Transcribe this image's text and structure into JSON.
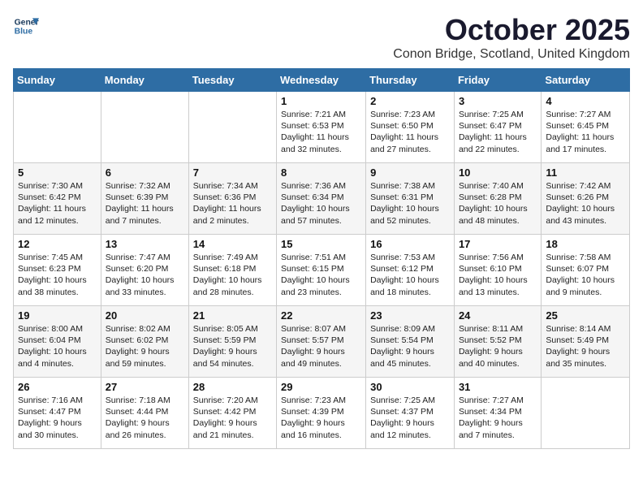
{
  "logo": {
    "line1": "General",
    "line2": "Blue"
  },
  "title": "October 2025",
  "location": "Conon Bridge, Scotland, United Kingdom",
  "weekdays": [
    "Sunday",
    "Monday",
    "Tuesday",
    "Wednesday",
    "Thursday",
    "Friday",
    "Saturday"
  ],
  "weeks": [
    [
      {
        "day": "",
        "info": ""
      },
      {
        "day": "",
        "info": ""
      },
      {
        "day": "",
        "info": ""
      },
      {
        "day": "1",
        "info": "Sunrise: 7:21 AM\nSunset: 6:53 PM\nDaylight: 11 hours\nand 32 minutes."
      },
      {
        "day": "2",
        "info": "Sunrise: 7:23 AM\nSunset: 6:50 PM\nDaylight: 11 hours\nand 27 minutes."
      },
      {
        "day": "3",
        "info": "Sunrise: 7:25 AM\nSunset: 6:47 PM\nDaylight: 11 hours\nand 22 minutes."
      },
      {
        "day": "4",
        "info": "Sunrise: 7:27 AM\nSunset: 6:45 PM\nDaylight: 11 hours\nand 17 minutes."
      }
    ],
    [
      {
        "day": "5",
        "info": "Sunrise: 7:30 AM\nSunset: 6:42 PM\nDaylight: 11 hours\nand 12 minutes."
      },
      {
        "day": "6",
        "info": "Sunrise: 7:32 AM\nSunset: 6:39 PM\nDaylight: 11 hours\nand 7 minutes."
      },
      {
        "day": "7",
        "info": "Sunrise: 7:34 AM\nSunset: 6:36 PM\nDaylight: 11 hours\nand 2 minutes."
      },
      {
        "day": "8",
        "info": "Sunrise: 7:36 AM\nSunset: 6:34 PM\nDaylight: 10 hours\nand 57 minutes."
      },
      {
        "day": "9",
        "info": "Sunrise: 7:38 AM\nSunset: 6:31 PM\nDaylight: 10 hours\nand 52 minutes."
      },
      {
        "day": "10",
        "info": "Sunrise: 7:40 AM\nSunset: 6:28 PM\nDaylight: 10 hours\nand 48 minutes."
      },
      {
        "day": "11",
        "info": "Sunrise: 7:42 AM\nSunset: 6:26 PM\nDaylight: 10 hours\nand 43 minutes."
      }
    ],
    [
      {
        "day": "12",
        "info": "Sunrise: 7:45 AM\nSunset: 6:23 PM\nDaylight: 10 hours\nand 38 minutes."
      },
      {
        "day": "13",
        "info": "Sunrise: 7:47 AM\nSunset: 6:20 PM\nDaylight: 10 hours\nand 33 minutes."
      },
      {
        "day": "14",
        "info": "Sunrise: 7:49 AM\nSunset: 6:18 PM\nDaylight: 10 hours\nand 28 minutes."
      },
      {
        "day": "15",
        "info": "Sunrise: 7:51 AM\nSunset: 6:15 PM\nDaylight: 10 hours\nand 23 minutes."
      },
      {
        "day": "16",
        "info": "Sunrise: 7:53 AM\nSunset: 6:12 PM\nDaylight: 10 hours\nand 18 minutes."
      },
      {
        "day": "17",
        "info": "Sunrise: 7:56 AM\nSunset: 6:10 PM\nDaylight: 10 hours\nand 13 minutes."
      },
      {
        "day": "18",
        "info": "Sunrise: 7:58 AM\nSunset: 6:07 PM\nDaylight: 10 hours\nand 9 minutes."
      }
    ],
    [
      {
        "day": "19",
        "info": "Sunrise: 8:00 AM\nSunset: 6:04 PM\nDaylight: 10 hours\nand 4 minutes."
      },
      {
        "day": "20",
        "info": "Sunrise: 8:02 AM\nSunset: 6:02 PM\nDaylight: 9 hours\nand 59 minutes."
      },
      {
        "day": "21",
        "info": "Sunrise: 8:05 AM\nSunset: 5:59 PM\nDaylight: 9 hours\nand 54 minutes."
      },
      {
        "day": "22",
        "info": "Sunrise: 8:07 AM\nSunset: 5:57 PM\nDaylight: 9 hours\nand 49 minutes."
      },
      {
        "day": "23",
        "info": "Sunrise: 8:09 AM\nSunset: 5:54 PM\nDaylight: 9 hours\nand 45 minutes."
      },
      {
        "day": "24",
        "info": "Sunrise: 8:11 AM\nSunset: 5:52 PM\nDaylight: 9 hours\nand 40 minutes."
      },
      {
        "day": "25",
        "info": "Sunrise: 8:14 AM\nSunset: 5:49 PM\nDaylight: 9 hours\nand 35 minutes."
      }
    ],
    [
      {
        "day": "26",
        "info": "Sunrise: 7:16 AM\nSunset: 4:47 PM\nDaylight: 9 hours\nand 30 minutes."
      },
      {
        "day": "27",
        "info": "Sunrise: 7:18 AM\nSunset: 4:44 PM\nDaylight: 9 hours\nand 26 minutes."
      },
      {
        "day": "28",
        "info": "Sunrise: 7:20 AM\nSunset: 4:42 PM\nDaylight: 9 hours\nand 21 minutes."
      },
      {
        "day": "29",
        "info": "Sunrise: 7:23 AM\nSunset: 4:39 PM\nDaylight: 9 hours\nand 16 minutes."
      },
      {
        "day": "30",
        "info": "Sunrise: 7:25 AM\nSunset: 4:37 PM\nDaylight: 9 hours\nand 12 minutes."
      },
      {
        "day": "31",
        "info": "Sunrise: 7:27 AM\nSunset: 4:34 PM\nDaylight: 9 hours\nand 7 minutes."
      },
      {
        "day": "",
        "info": ""
      }
    ]
  ]
}
